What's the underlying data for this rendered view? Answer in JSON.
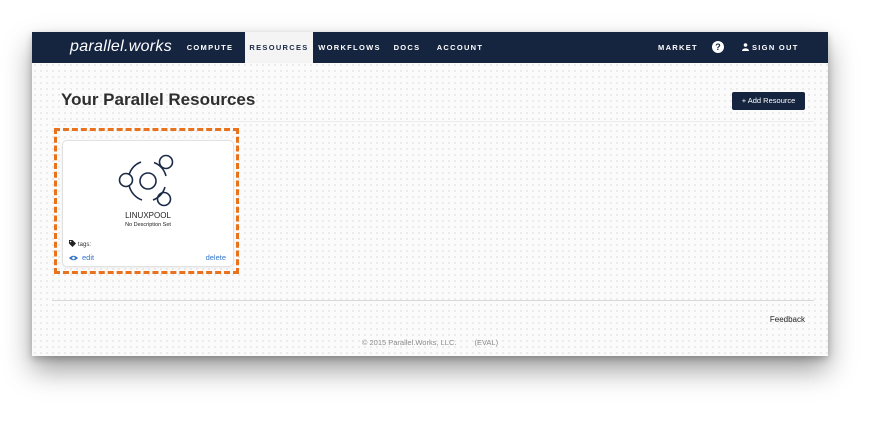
{
  "nav": {
    "brand": "parallel.works",
    "items": [
      {
        "label": "COMPUTE"
      },
      {
        "label": "RESOURCES",
        "active": true
      },
      {
        "label": "WORKFLOWS"
      },
      {
        "label": "DOCS"
      },
      {
        "label": "ACCOUNT"
      }
    ],
    "market_label": "MARKET",
    "help_icon": "question-circle-icon",
    "signout_label": "SIGN OUT",
    "signout_icon": "user-icon"
  },
  "page": {
    "title": "Your Parallel Resources",
    "add_button_label": "+ Add Resource"
  },
  "resources": [
    {
      "name": "LINUXPOOL",
      "description": "No Description Set",
      "icon": "ubuntu-logo-icon",
      "tags_label": "tags:",
      "edit_label": "edit",
      "delete_label": "delete"
    }
  ],
  "footer": {
    "feedback_label": "Feedback",
    "copyright": "© 2015 Parallel.Works, LLC.",
    "edition": "(EVAL)"
  },
  "colors": {
    "nav_background": "#15243f",
    "link": "#3577c6",
    "highlight": "#e8731c"
  }
}
